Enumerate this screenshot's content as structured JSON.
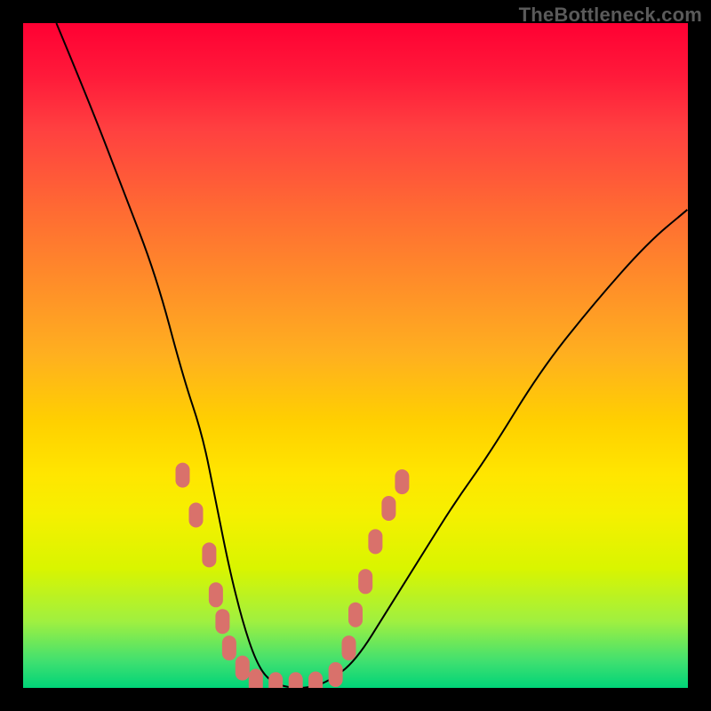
{
  "watermark": {
    "text": "TheBottleneck.com"
  },
  "colors": {
    "background": "#000000",
    "curve": "#000000",
    "marker": "#d9716b",
    "gradient_top": "#ff0033",
    "gradient_mid": "#ffe600",
    "gradient_bottom": "#00d478"
  },
  "chart_data": {
    "type": "line",
    "title": "",
    "xlabel": "",
    "ylabel": "",
    "xlim": [
      0,
      100
    ],
    "ylim": [
      0,
      100
    ],
    "grid": false,
    "legend": false,
    "annotations": [
      "TheBottleneck.com"
    ],
    "series": [
      {
        "name": "bottleneck-curve",
        "x": [
          5,
          10,
          15,
          20,
          24,
          27,
          29,
          31,
          33,
          35,
          37,
          40,
          43,
          46,
          50,
          55,
          60,
          65,
          70,
          78,
          86,
          94,
          100
        ],
        "values": [
          100,
          88,
          75,
          62,
          47,
          38,
          28,
          18,
          10,
          4,
          1,
          0,
          0,
          1,
          4,
          12,
          20,
          28,
          35,
          48,
          58,
          67,
          72
        ]
      }
    ],
    "markers": {
      "name": "salmon-pill-markers",
      "color": "#d9716b",
      "points": [
        [
          24,
          32
        ],
        [
          26,
          26
        ],
        [
          28,
          20
        ],
        [
          29,
          14
        ],
        [
          30,
          10
        ],
        [
          31,
          6
        ],
        [
          33,
          3
        ],
        [
          35,
          1
        ],
        [
          38,
          0.5
        ],
        [
          41,
          0.5
        ],
        [
          44,
          0.6
        ],
        [
          47,
          2
        ],
        [
          49,
          6
        ],
        [
          50,
          11
        ],
        [
          51.5,
          16
        ],
        [
          53,
          22
        ],
        [
          55,
          27
        ],
        [
          57,
          31
        ]
      ]
    }
  }
}
